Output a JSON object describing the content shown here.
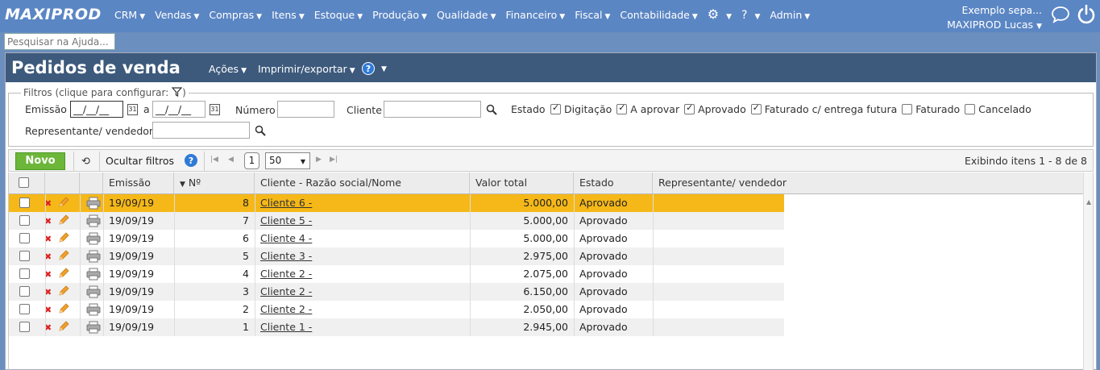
{
  "app": {
    "logo": "MAXIPROD",
    "nav": [
      {
        "label": "CRM"
      },
      {
        "label": "Vendas"
      },
      {
        "label": "Compras"
      },
      {
        "label": "Itens"
      },
      {
        "label": "Estoque"
      },
      {
        "label": "Produção"
      },
      {
        "label": "Qualidade"
      },
      {
        "label": "Financeiro"
      },
      {
        "label": "Fiscal"
      },
      {
        "label": "Contabilidade"
      }
    ],
    "admin_label": "Admin",
    "user_company": "Exemplo sepa...",
    "user_name": "MAXIPROD Lucas",
    "help_search_placeholder": "Pesquisar na Ajuda..."
  },
  "page": {
    "title": "Pedidos de venda",
    "actions_label": "Ações",
    "print_export_label": "Imprimir/exportar"
  },
  "filters": {
    "legend": "Filtros (clique para configurar:",
    "legend_close": ")",
    "emissao_label": "Emissão",
    "date_from": "__/__/__",
    "a_label": "a",
    "date_to": "__/__/__",
    "numero_label": "Número",
    "numero_value": "",
    "cliente_label": "Cliente",
    "cliente_value": "",
    "estado_label": "Estado",
    "estado_options": [
      {
        "label": "Digitação",
        "checked": true
      },
      {
        "label": "A aprovar",
        "checked": true
      },
      {
        "label": "Aprovado",
        "checked": true
      },
      {
        "label": "Faturado c/ entrega futura",
        "checked": true
      },
      {
        "label": "Faturado",
        "checked": false
      },
      {
        "label": "Cancelado",
        "checked": false
      }
    ],
    "representante_label": "Representante/ vendedor",
    "representante_value": ""
  },
  "toolbar": {
    "new_label": "Novo",
    "hide_filters_label": "Ocultar filtros",
    "current_page": "1",
    "page_size": "50",
    "items_info": "Exibindo itens 1 - 8 de 8"
  },
  "table": {
    "columns": {
      "emissao": "Emissão",
      "numero": "Nº",
      "cliente": "Cliente - Razão social/Nome",
      "valor": "Valor total",
      "estado": "Estado",
      "representante": "Representante/ vendedor"
    },
    "rows": [
      {
        "emissao": "19/09/19",
        "numero": "8",
        "cliente": "Cliente 6 -",
        "valor": "5.000,00",
        "estado": "Aprovado",
        "representante": "",
        "selected": true
      },
      {
        "emissao": "19/09/19",
        "numero": "7",
        "cliente": "Cliente 5 -",
        "valor": "5.000,00",
        "estado": "Aprovado",
        "representante": ""
      },
      {
        "emissao": "19/09/19",
        "numero": "6",
        "cliente": "Cliente 4 -",
        "valor": "5.000,00",
        "estado": "Aprovado",
        "representante": ""
      },
      {
        "emissao": "19/09/19",
        "numero": "5",
        "cliente": "Cliente 3 -",
        "valor": "2.975,00",
        "estado": "Aprovado",
        "representante": ""
      },
      {
        "emissao": "19/09/19",
        "numero": "4",
        "cliente": "Cliente 2 -",
        "valor": "2.075,00",
        "estado": "Aprovado",
        "representante": ""
      },
      {
        "emissao": "19/09/19",
        "numero": "3",
        "cliente": "Cliente 2 -",
        "valor": "6.150,00",
        "estado": "Aprovado",
        "representante": ""
      },
      {
        "emissao": "19/09/19",
        "numero": "2",
        "cliente": "Cliente 2 -",
        "valor": "2.050,00",
        "estado": "Aprovado",
        "representante": ""
      },
      {
        "emissao": "19/09/19",
        "numero": "1",
        "cliente": "Cliente 1 -",
        "valor": "2.945,00",
        "estado": "Aprovado",
        "representante": ""
      }
    ]
  },
  "colors": {
    "topbar": "#5b86c4",
    "title_bar": "#3d5a7c",
    "selected_row": "#f5b818",
    "new_button": "#6cb63a"
  }
}
